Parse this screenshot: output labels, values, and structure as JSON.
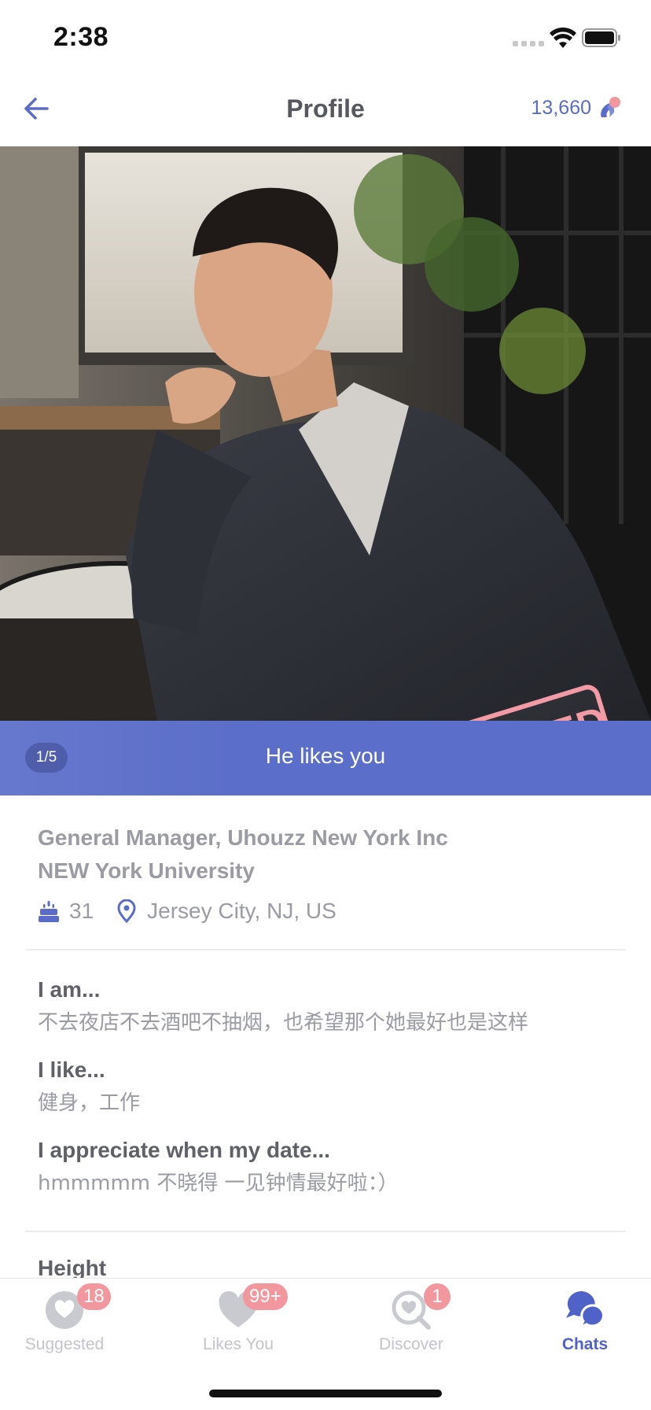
{
  "status_bar": {
    "time": "2:38"
  },
  "nav": {
    "title": "Profile",
    "coins": "13,660"
  },
  "photo": {
    "stamp": "CONNECTED",
    "counter": "1/5"
  },
  "banner": {
    "text": "He likes you"
  },
  "profile": {
    "job": "General Manager, Uhouzz New York Inc",
    "school": "NEW York University",
    "age": "31",
    "location": "Jersey City, NJ, US"
  },
  "prompts": [
    {
      "question": "I am...",
      "answer": "不去夜店不去酒吧不抽烟，也希望那个她最好也是这样"
    },
    {
      "question": "I like...",
      "answer": "健身，工作"
    },
    {
      "question": "I appreciate when my date...",
      "answer": "hmmmmm 不晓得 一见钟情最好啦：）"
    }
  ],
  "height_label": "Height",
  "tabs": [
    {
      "label": "Suggested",
      "badge": "18",
      "icon": "heart-bubble-icon"
    },
    {
      "label": "Likes You",
      "badge": "99+",
      "icon": "heart-icon"
    },
    {
      "label": "Discover",
      "badge": "1",
      "icon": "heart-search-icon"
    },
    {
      "label": "Chats",
      "badge": "",
      "icon": "chat-bubbles-icon"
    }
  ],
  "colors": {
    "accent": "#5b6ec9",
    "stamp": "#f29aa6",
    "badge": "#f3979e",
    "muted_text": "#9a9ba3"
  }
}
